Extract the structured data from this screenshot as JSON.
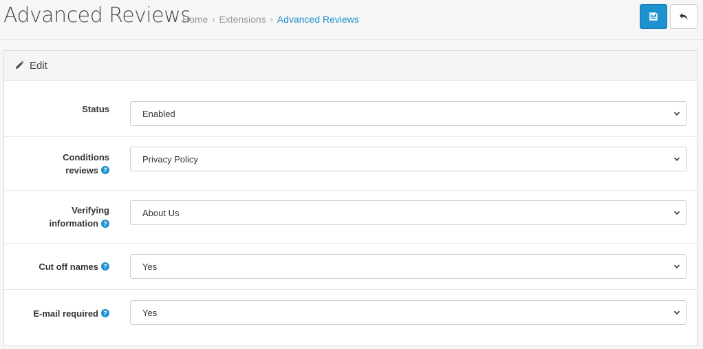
{
  "header": {
    "title": "Advanced Reviews",
    "breadcrumb": [
      "Home",
      "Extensions",
      "Advanced Reviews"
    ],
    "save_icon": "save-icon",
    "back_icon": "reply-icon"
  },
  "panel": {
    "title": "Edit",
    "icon": "pencil-icon"
  },
  "form": {
    "status": {
      "label": "Status",
      "value": "Enabled"
    },
    "conditions_reviews": {
      "label_line1": "Conditions",
      "label_line2": "reviews",
      "value": "Privacy Policy"
    },
    "verifying_information": {
      "label_line1": "Verifying",
      "label_line2": "information",
      "value": "About Us"
    },
    "cut_off_names": {
      "label": "Cut off names",
      "value": "Yes"
    },
    "email_required": {
      "label": "E-mail required",
      "value": "Yes"
    }
  },
  "colors": {
    "primary": "#1e91cf",
    "background": "#f6f6f6",
    "panel_heading": "#f5f5f5"
  }
}
